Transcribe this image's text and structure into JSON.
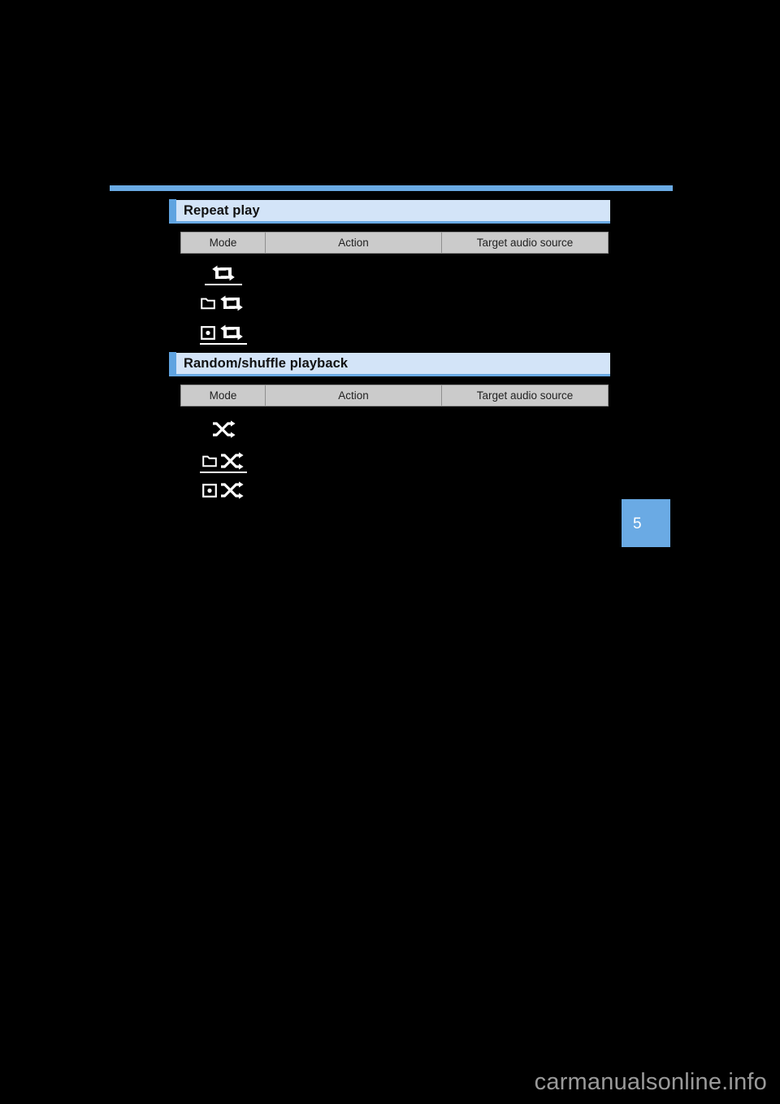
{
  "page": {
    "background_color": "#000000",
    "accent_color": "#6aaae4",
    "header_bg_color": "#d3e4f8",
    "table_header_bg_color": "#cbcbcb",
    "page_number": "5",
    "watermark": "carmanualsonline.info"
  },
  "sections": [
    {
      "id": "repeat",
      "title": "Repeat play",
      "columns": [
        "Mode",
        "Action",
        "Target audio source"
      ],
      "rows": [
        {
          "mode_icon": "repeat-icon",
          "action": "",
          "target": ""
        },
        {
          "mode_icon": "folder-repeat-icon",
          "action": "",
          "target": ""
        },
        {
          "mode_icon": "disc-repeat-icon",
          "action": "",
          "target": ""
        }
      ]
    },
    {
      "id": "random",
      "title": "Random/shuffle playback",
      "columns": [
        "Mode",
        "Action",
        "Target audio source"
      ],
      "rows": [
        {
          "mode_icon": "shuffle-icon",
          "action": "",
          "target": ""
        },
        {
          "mode_icon": "folder-shuffle-icon",
          "action": "",
          "target": ""
        },
        {
          "mode_icon": "disc-shuffle-icon",
          "action": "",
          "target": ""
        }
      ]
    }
  ]
}
